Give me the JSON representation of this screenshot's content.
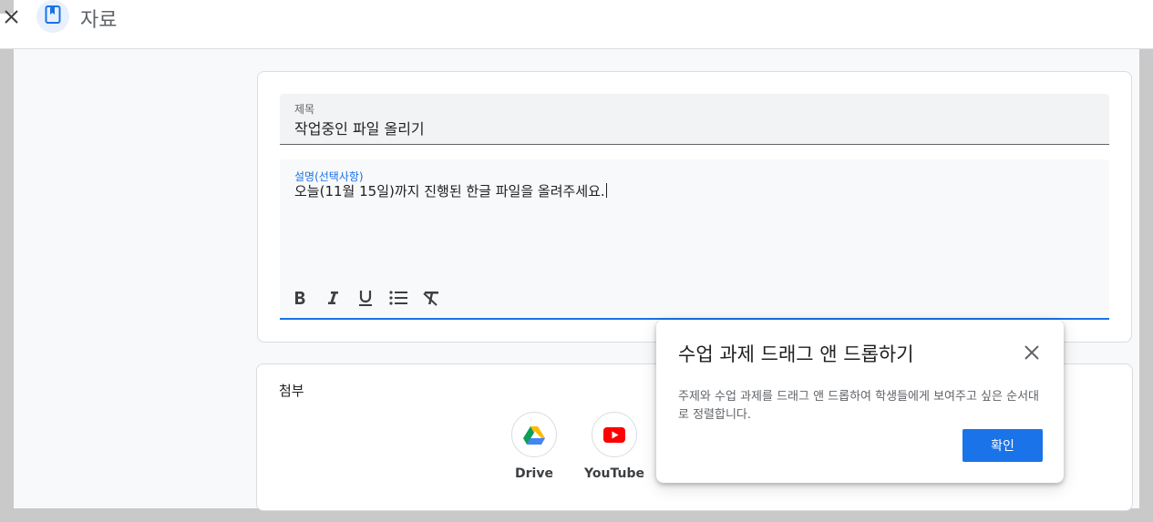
{
  "header": {
    "title": "자료",
    "close_icon": "close-icon",
    "title_icon": "bookmark-icon"
  },
  "form": {
    "title_label": "제목",
    "title_value": "작업중인 파일 올리기",
    "description_label": "설명(선택사항)",
    "description_value": "오늘(11월 15일)까지 진행된 한글 파일을 올려주세요.",
    "toolbar": [
      "bold-icon",
      "italic-icon",
      "underline-icon",
      "bulleted-list-icon",
      "clear-formatting-icon"
    ]
  },
  "attach": {
    "label": "첨부",
    "items": [
      {
        "label": "Drive",
        "icon": "google-drive-icon"
      },
      {
        "label": "YouTube",
        "icon": "youtube-icon"
      }
    ]
  },
  "tooltip": {
    "title": "수업 과제 드래그 앤 드롭하기",
    "body": "주제와 수업 과제를 드래그 앤 드롭하여 학생들에게 보여주고 싶은 순서대로 정렬합니다.",
    "confirm_label": "확인"
  },
  "colors": {
    "accent": "#1a73e8",
    "youtube_red": "#ff0000"
  }
}
